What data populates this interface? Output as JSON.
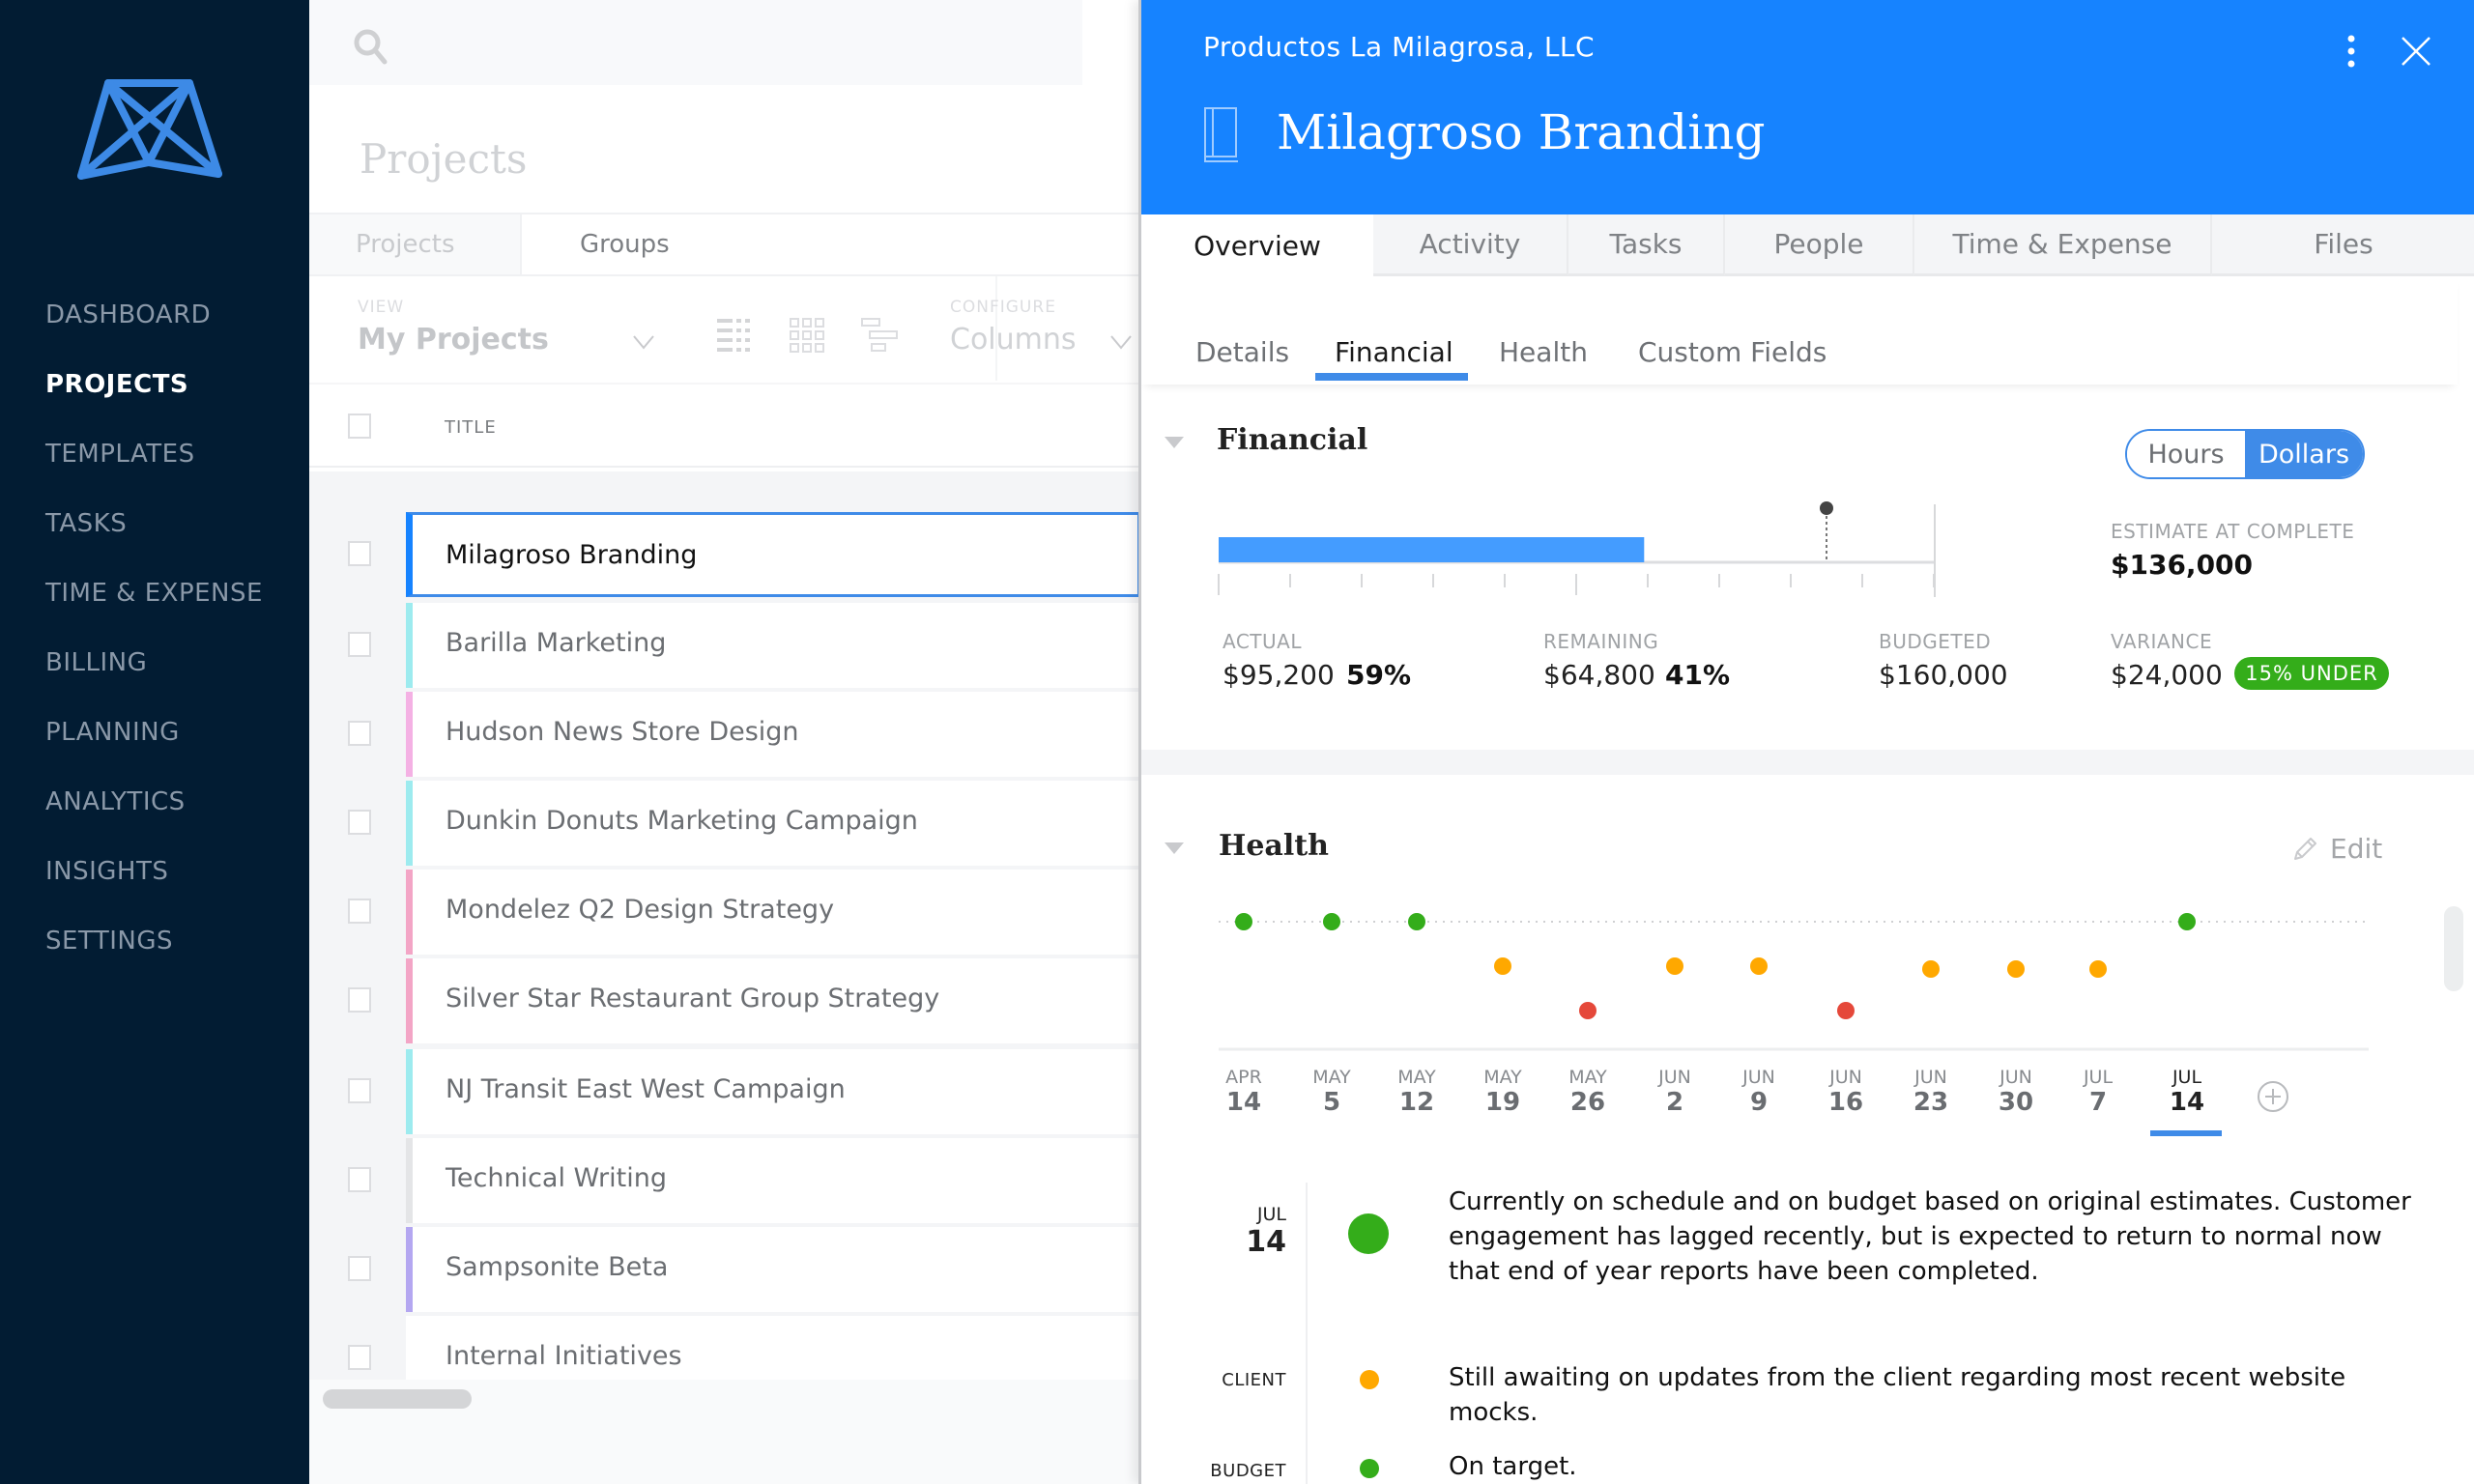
{
  "sidebar": {
    "logo": "mavenlink-logo",
    "items": [
      {
        "label": "DASHBOARD",
        "active": false
      },
      {
        "label": "PROJECTS",
        "active": true
      },
      {
        "label": "TEMPLATES",
        "active": false
      },
      {
        "label": "TASKS",
        "active": false
      },
      {
        "label": "TIME & EXPENSE",
        "active": false
      },
      {
        "label": "BILLING",
        "active": false
      },
      {
        "label": "PLANNING",
        "active": false
      },
      {
        "label": "ANALYTICS",
        "active": false
      },
      {
        "label": "INSIGHTS",
        "active": false
      },
      {
        "label": "SETTINGS",
        "active": false
      }
    ]
  },
  "list": {
    "search_placeholder": "",
    "title": "Projects",
    "tabs": [
      "Projects",
      "Groups"
    ],
    "view_label": "VIEW",
    "view_value": "My Projects",
    "configure_label": "CONFIGURE",
    "configure_value": "Columns",
    "column_title": "TITLE",
    "rows": [
      {
        "name": "Milagroso Branding",
        "color": "#1683ff",
        "selected": true
      },
      {
        "name": "Barilla Marketing",
        "color": "#9debef"
      },
      {
        "name": "Hudson News Store Design",
        "color": "#f4b1e4"
      },
      {
        "name": "Dunkin Donuts Marketing Campaign",
        "color": "#9debef"
      },
      {
        "name": "Mondelez Q2 Design Strategy",
        "color": "#f3a5c6"
      },
      {
        "name": "Silver Star Restaurant Group Strategy",
        "color": "#f3a5c6"
      },
      {
        "name": "NJ Transit East West Campaign",
        "color": "#9debef"
      },
      {
        "name": "Technical Writing",
        "color": "#e4e5e7"
      },
      {
        "name": "Sampsonite Beta",
        "color": "#b4a7f1"
      },
      {
        "name": "Internal Initiatives",
        "color": "#ffffff"
      }
    ]
  },
  "detail": {
    "client": "Productos La Milagrosa, LLC",
    "title": "Milagroso Branding",
    "tabs": [
      {
        "label": "Overview",
        "active": true
      },
      {
        "label": "Activity"
      },
      {
        "label": "Tasks"
      },
      {
        "label": "People"
      },
      {
        "label": "Time & Expense"
      },
      {
        "label": "Files"
      }
    ],
    "subtabs": [
      {
        "label": "Details"
      },
      {
        "label": "Financial",
        "active": true
      },
      {
        "label": "Health"
      },
      {
        "label": "Custom Fields"
      }
    ],
    "financial": {
      "title": "Financial",
      "toggle": {
        "options": [
          "Hours",
          "Dollars"
        ],
        "selected": "Dollars"
      },
      "actual_label": "ACTUAL",
      "actual_value": "$95,200",
      "actual_pct": "59%",
      "remaining_label": "REMAINING",
      "remaining_value": "$64,800",
      "remaining_pct": "41%",
      "budgeted_label": "BUDGETED",
      "budgeted_value": "$160,000",
      "eac_label": "ESTIMATE AT COMPLETE",
      "eac_value": "$136,000",
      "variance_label": "VARIANCE",
      "variance_value": "$24,000",
      "variance_badge": "15% UNDER",
      "bar": {
        "actual": 95200,
        "budget": 160000,
        "estimate": 136000,
        "ticks": 10
      },
      "colors": {
        "bar": "#449cff",
        "badge": "#34ad1a"
      }
    },
    "health": {
      "title": "Health",
      "edit_label": "Edit",
      "colors": {
        "good": "#34ad1a",
        "warning": "#ffa800",
        "bad": "#e5483a"
      },
      "points": [
        {
          "month": "APR",
          "day": "14",
          "status": "good"
        },
        {
          "month": "MAY",
          "day": "5",
          "status": "good"
        },
        {
          "month": "MAY",
          "day": "12",
          "status": "good"
        },
        {
          "month": "MAY",
          "day": "19",
          "status": "warning"
        },
        {
          "month": "MAY",
          "day": "26",
          "status": "bad"
        },
        {
          "month": "JUN",
          "day": "2",
          "status": "warning"
        },
        {
          "month": "JUN",
          "day": "9",
          "status": "warning"
        },
        {
          "month": "JUN",
          "day": "16",
          "status": "bad"
        },
        {
          "month": "JUN",
          "day": "23",
          "status": "warning"
        },
        {
          "month": "JUN",
          "day": "30",
          "status": "warning"
        },
        {
          "month": "JUL",
          "day": "7",
          "status": "warning"
        },
        {
          "month": "JUL",
          "day": "14",
          "status": "good",
          "active": true
        }
      ],
      "note": {
        "month": "JUL",
        "day": "14",
        "status": "good",
        "text": "Currently on schedule and on budget based on original estimates. Customer engagement has lagged recently, but is expected to return to normal now that end of year reports have been completed."
      },
      "categories": [
        {
          "label": "CLIENT",
          "status": "warning",
          "text": "Still awaiting on updates from the client regarding most recent website mocks."
        },
        {
          "label": "BUDGET",
          "status": "good",
          "text": "On target."
        }
      ]
    }
  }
}
